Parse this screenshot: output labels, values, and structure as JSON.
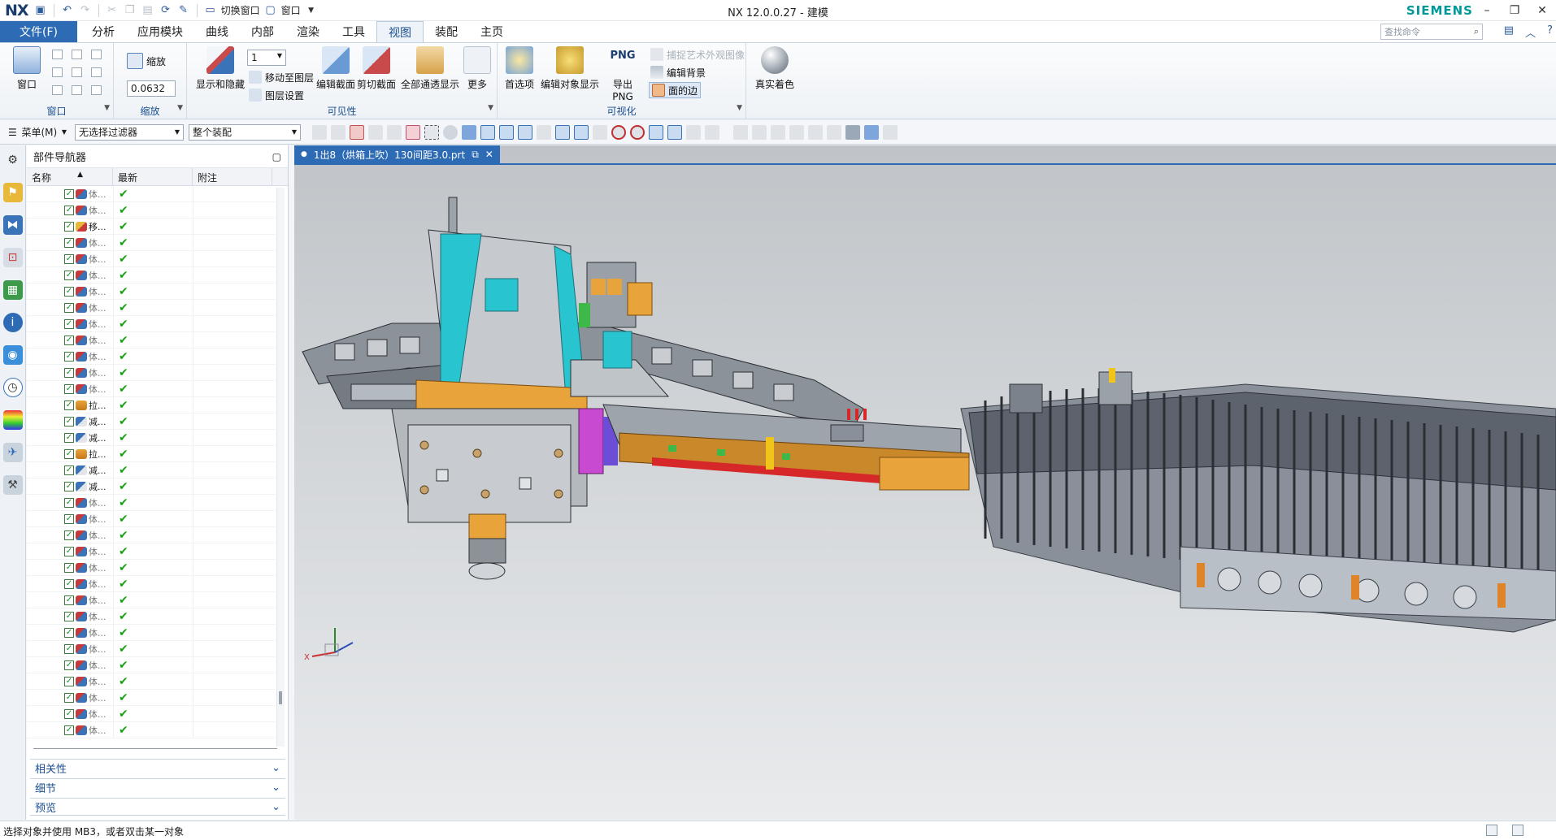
{
  "app": {
    "logo": "NX",
    "title": "NX 12.0.0.27 - 建模",
    "brand": "SIEMENS",
    "quick_access": {
      "switch_window": "切换窗口",
      "window": "窗口"
    }
  },
  "tabs": [
    "文件(F)",
    "分析",
    "应用模块",
    "曲线",
    "内部",
    "渲染",
    "工具",
    "视图",
    "装配",
    "主页"
  ],
  "active_tab": "视图",
  "search": {
    "placeholder": "查找命令"
  },
  "ribbon": {
    "window_group": {
      "label": "窗口",
      "button": "窗口"
    },
    "zoom_group": {
      "label": "缩放",
      "button": "缩放",
      "value": "0.0632"
    },
    "visibility_group": {
      "label": "可见性",
      "layer_value": "1",
      "show_hide": "显示和隐藏",
      "move_to_layer": "移动至图层",
      "layer_settings": "图层设置",
      "edit_section": "编辑截面",
      "clip_section": "剪切截面",
      "all_pass": "全部通透显示",
      "more": "更多"
    },
    "visualization_group": {
      "label": "可视化",
      "preferences": "首选项",
      "edit_object_display": "编辑对象显示",
      "export_png_icon": "PNG",
      "export_png": "导出 PNG",
      "capture_art": "捕捉艺术外观图像",
      "edit_background": "编辑背景",
      "face_edges": "面的边"
    },
    "true_shading": "真实着色"
  },
  "selection_bar": {
    "menu": "菜单(M)",
    "filter": "无选择过滤器",
    "scope": "整个装配"
  },
  "navigator": {
    "title": "部件导航器",
    "columns": [
      "名称",
      "最新",
      "附注"
    ],
    "rows": [
      {
        "label": "体...",
        "kind": "body"
      },
      {
        "label": "体...",
        "kind": "body"
      },
      {
        "label": "移...",
        "kind": "move"
      },
      {
        "label": "体...",
        "kind": "body"
      },
      {
        "label": "体...",
        "kind": "body"
      },
      {
        "label": "体...",
        "kind": "body"
      },
      {
        "label": "体...",
        "kind": "body"
      },
      {
        "label": "体...",
        "kind": "body"
      },
      {
        "label": "体...",
        "kind": "body"
      },
      {
        "label": "体...",
        "kind": "body"
      },
      {
        "label": "体...",
        "kind": "body"
      },
      {
        "label": "体...",
        "kind": "body"
      },
      {
        "label": "体...",
        "kind": "body"
      },
      {
        "label": "拉...",
        "kind": "extrude"
      },
      {
        "label": "减...",
        "kind": "subtract"
      },
      {
        "label": "减...",
        "kind": "subtract"
      },
      {
        "label": "拉...",
        "kind": "extrude"
      },
      {
        "label": "减...",
        "kind": "subtract"
      },
      {
        "label": "减...",
        "kind": "subtract"
      },
      {
        "label": "体...",
        "kind": "body"
      },
      {
        "label": "体...",
        "kind": "body"
      },
      {
        "label": "体...",
        "kind": "body"
      },
      {
        "label": "体...",
        "kind": "body"
      },
      {
        "label": "体...",
        "kind": "body"
      },
      {
        "label": "体...",
        "kind": "body"
      },
      {
        "label": "体...",
        "kind": "body"
      },
      {
        "label": "体...",
        "kind": "body"
      },
      {
        "label": "体...",
        "kind": "body"
      },
      {
        "label": "体...",
        "kind": "body"
      },
      {
        "label": "体...",
        "kind": "body"
      },
      {
        "label": "体...",
        "kind": "body"
      },
      {
        "label": "体...",
        "kind": "body"
      },
      {
        "label": "体...",
        "kind": "body"
      },
      {
        "label": "体...",
        "kind": "body"
      }
    ],
    "sections": [
      "相关性",
      "细节",
      "预览"
    ]
  },
  "graphics": {
    "tab_title": "1出8（烘箱上吹）130间距3.0.prt",
    "axis_x": "X"
  },
  "status": {
    "text": "选择对象并使用 MB3，或者双击某一对象"
  },
  "colors": {
    "accent": "#2d6bb5",
    "brand": "#009999",
    "check": "#18a018"
  }
}
